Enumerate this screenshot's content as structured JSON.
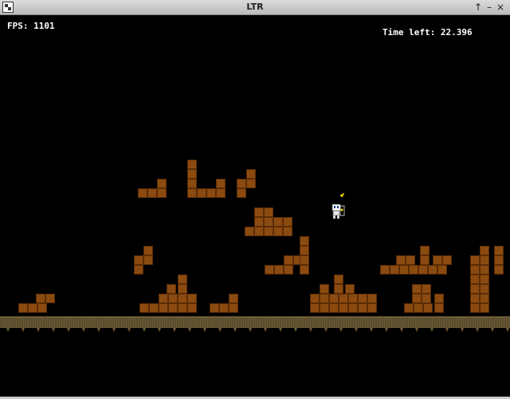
{
  "window": {
    "title": "LTR"
  },
  "hud": {
    "fps": "FPS: 1101",
    "time_left": "Time left: 22.396"
  },
  "colors": {
    "brick": "#8b4a10",
    "brick_edge": "#5a2c05",
    "ground": "#6b5a37",
    "background": "#000000"
  },
  "icons": {
    "maximize": "↑",
    "minimize": "–",
    "close": "×"
  }
}
